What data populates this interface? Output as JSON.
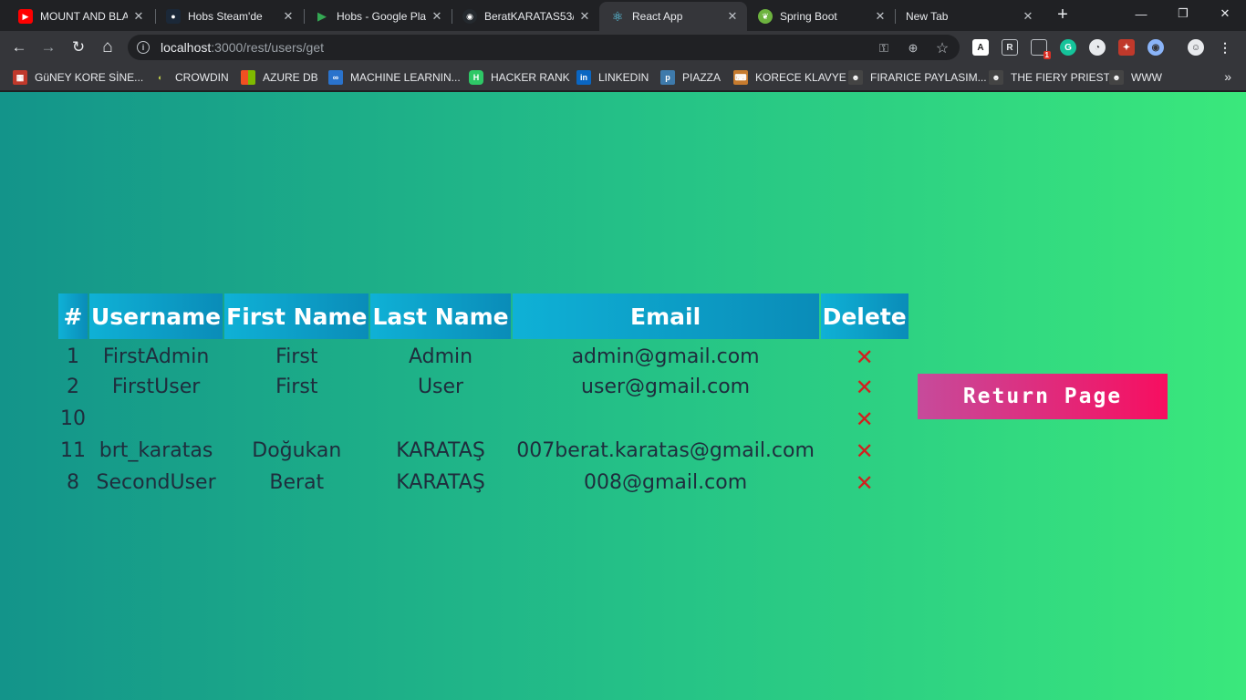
{
  "browser": {
    "tabs": [
      {
        "title": "MOUNT AND BLA",
        "icon": "youtube-icon",
        "color": "#ff0000",
        "active": false
      },
      {
        "title": "Hobs Steam'de",
        "icon": "steam-icon",
        "color": "#1b2838",
        "active": false
      },
      {
        "title": "Hobs - Google Pla",
        "icon": "google-play-icon",
        "color": "#34a853",
        "active": false
      },
      {
        "title": "BeratKARATAS53/",
        "icon": "github-icon",
        "color": "#24292e",
        "active": false
      },
      {
        "title": "React App",
        "icon": "react-icon",
        "color": "#61dafb",
        "active": true
      },
      {
        "title": "Spring Boot",
        "icon": "spring-icon",
        "color": "#6db33f",
        "active": false
      },
      {
        "title": "New Tab",
        "icon": "",
        "color": "",
        "active": false
      }
    ],
    "new_tab_symbol": "+",
    "window_controls": {
      "minimize": "—",
      "maximize": "❐",
      "close": "✕"
    },
    "nav": {
      "back": "←",
      "forward": "→",
      "reload": "↻",
      "home": "⌂"
    },
    "address": {
      "host": "localhost",
      "path": ":3000/rest/users/get"
    },
    "extension_badge": "1",
    "bookmarks": [
      {
        "label": "GüNEY KORE SİNE...",
        "icon": "film-icon",
        "color": "#c0392b"
      },
      {
        "label": "CROWDIN",
        "icon": "crowdin-icon",
        "color": "#2e2e2e"
      },
      {
        "label": "AZURE DB",
        "icon": "microsoft-icon",
        "color": "#f25022"
      },
      {
        "label": "MACHINE LEARNIN...",
        "icon": "coursera-icon",
        "color": "#2a73cc"
      },
      {
        "label": "HACKER RANK",
        "icon": "hackerrank-icon",
        "color": "#2ec866"
      },
      {
        "label": "LINKEDIN",
        "icon": "linkedin-icon",
        "color": "#0a66c2"
      },
      {
        "label": "PIAZZA",
        "icon": "piazza-icon",
        "color": "#3e7aab"
      },
      {
        "label": "KORECE KLAVYE",
        "icon": "keyboard-icon",
        "color": "#c67b2e"
      },
      {
        "label": "FIRARICE PAYLASIM...",
        "icon": "manga-icon",
        "color": "#444444"
      },
      {
        "label": "THE FIERY PRIEST",
        "icon": "manga-icon",
        "color": "#444444"
      },
      {
        "label": "WWW",
        "icon": "manga-icon",
        "color": "#444444"
      }
    ],
    "bookmarks_more": "»"
  },
  "users_table": {
    "headers": [
      "#",
      "Username",
      "First Name",
      "Last Name",
      "Email",
      "Delete"
    ],
    "delete_symbol": "✕",
    "rows": [
      {
        "id": "1",
        "username": "FirstAdmin",
        "first_name": "First",
        "last_name": "Admin",
        "email": "admin@gmail.com"
      },
      {
        "id": "2",
        "username": "FirstUser",
        "first_name": "First",
        "last_name": "User",
        "email": "user@gmail.com"
      },
      {
        "id": "10",
        "username": "",
        "first_name": "",
        "last_name": "",
        "email": ""
      },
      {
        "id": "11",
        "username": "brt_karatas",
        "first_name": "Doğukan",
        "last_name": "KARATAŞ",
        "email": "007berat.karatas@gmail.com"
      },
      {
        "id": "8",
        "username": "SecondUser",
        "first_name": "Berat",
        "last_name": "KARATAŞ",
        "email": "008@gmail.com"
      }
    ]
  },
  "return_button": {
    "label": "Return Page"
  },
  "colors": {
    "background_start": "#13948a",
    "background_end": "#3ae87c",
    "header_cell": "#0fb1d6",
    "delete_icon": "#d21f1f",
    "return_button_start": "#c64b9b",
    "return_button_end": "#f70e60"
  }
}
